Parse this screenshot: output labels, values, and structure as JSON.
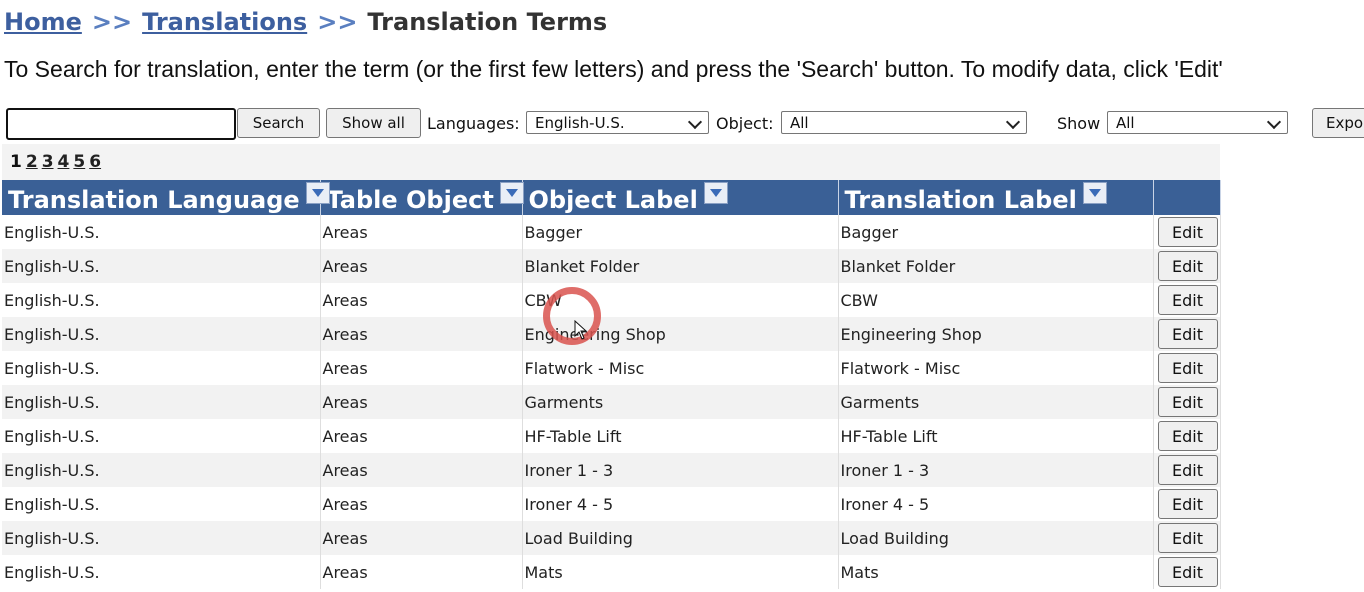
{
  "breadcrumb": {
    "home": "Home",
    "separator": ">>",
    "translations": "Translations",
    "current": "Translation Terms"
  },
  "instructions": "To Search for translation, enter the term (or the first few letters) and press the 'Search' button. To modify data, click 'Edit'",
  "toolbar": {
    "search_value": "",
    "search_button": "Search",
    "show_all_button": "Show all",
    "languages_label": "Languages:",
    "languages_value": "English-U.S.",
    "object_label": "Object:",
    "object_value": "All",
    "show_label": "Show",
    "show_value": "All",
    "export_button": "Expo"
  },
  "pager": {
    "current": "1",
    "pages": [
      "2",
      "3",
      "4",
      "5",
      "6"
    ]
  },
  "table": {
    "headers": [
      "Translation Language",
      "Table Object",
      "Object Label",
      "Translation Label"
    ],
    "edit_label": "Edit",
    "rows": [
      [
        "English-U.S.",
        "Areas",
        "Bagger",
        "Bagger"
      ],
      [
        "English-U.S.",
        "Areas",
        "Blanket Folder",
        "Blanket Folder"
      ],
      [
        "English-U.S.",
        "Areas",
        "CBW",
        "CBW"
      ],
      [
        "English-U.S.",
        "Areas",
        "Engineering Shop",
        "Engineering Shop"
      ],
      [
        "English-U.S.",
        "Areas",
        "Flatwork - Misc",
        "Flatwork - Misc"
      ],
      [
        "English-U.S.",
        "Areas",
        "Garments",
        "Garments"
      ],
      [
        "English-U.S.",
        "Areas",
        "HF-Table Lift",
        "HF-Table Lift"
      ],
      [
        "English-U.S.",
        "Areas",
        "Ironer 1 - 3",
        "Ironer 1 - 3"
      ],
      [
        "English-U.S.",
        "Areas",
        "Ironer 4 - 5",
        "Ironer 4 - 5"
      ],
      [
        "English-U.S.",
        "Areas",
        "Load Building",
        "Load Building"
      ],
      [
        "English-U.S.",
        "Areas",
        "Mats",
        "Mats"
      ]
    ]
  },
  "colors": {
    "header_bg": "#3a6096",
    "link": "#3d5f9f",
    "click_marker": "#d9534f"
  }
}
